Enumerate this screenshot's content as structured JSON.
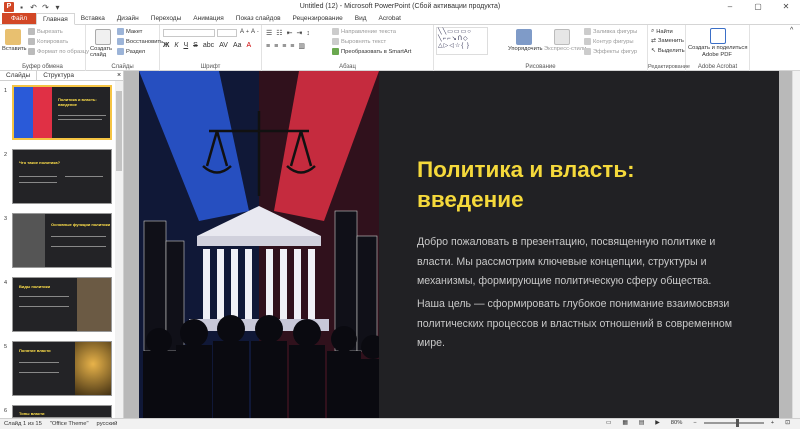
{
  "window": {
    "title": "Untitled (12) - Microsoft PowerPoint (Сбой активации продукта)",
    "logo": "P"
  },
  "tabs": [
    {
      "label": "Файл"
    },
    {
      "label": "Главная"
    },
    {
      "label": "Вставка"
    },
    {
      "label": "Дизайн"
    },
    {
      "label": "Переходы"
    },
    {
      "label": "Анимация"
    },
    {
      "label": "Показ слайдов"
    },
    {
      "label": "Рецензирование"
    },
    {
      "label": "Вид"
    },
    {
      "label": "Acrobat"
    }
  ],
  "ribbon": {
    "clipboard": {
      "paste": "Вставить",
      "cut": "Вырезать",
      "copy": "Копировать",
      "format": "Формат по образцу",
      "label": "Буфер обмена"
    },
    "slides": {
      "new": "Создать слайд",
      "layout": "Макет",
      "reset": "Восстановить",
      "section": "Раздел",
      "label": "Слайды"
    },
    "font": {
      "label": "Шрифт"
    },
    "paragraph": {
      "direction": "Направление текста",
      "align": "Выровнять текст",
      "smartart": "Преобразовать в SmartArt",
      "label": "Абзац"
    },
    "drawing": {
      "arrange": "Упорядочить",
      "styles": "Экспресс-стили",
      "fill": "Заливка фигуры",
      "outline": "Контур фигуры",
      "effects": "Эффекты фигур",
      "label": "Рисование"
    },
    "editing": {
      "find": "Найти",
      "replace": "Заменить",
      "select": "Выделить",
      "label": "Редактирование"
    },
    "acrobat": {
      "create": "Создать и поделиться",
      "create2": "Adobe PDF",
      "label": "Adobe Acrobat"
    }
  },
  "panel": {
    "tab_slides": "Слайды",
    "tab_outline": "Структура",
    "close": "×"
  },
  "thumbnails": [
    {
      "num": "1",
      "title": "Политика и власть: введение"
    },
    {
      "num": "2",
      "title": "Что такое политика?"
    },
    {
      "num": "3",
      "title": "Основные функции политики"
    },
    {
      "num": "4",
      "title": "Виды политики"
    },
    {
      "num": "5",
      "title": "Понятие власти"
    },
    {
      "num": "6",
      "title": "Типы власти"
    }
  ],
  "slide": {
    "title_line1": "Политика и власть:",
    "title_line2": "введение",
    "para1": "Добро пожаловать в презентацию, посвященную политике и власти. Мы рассмотрим ключевые концепции, структуры и механизмы, формирующие политическую сферу общества.",
    "para2": "Наша цель — сформировать глубокое понимание взаимосвязи политических процессов и властных отношений в современном мире."
  },
  "status": {
    "slide": "Слайд 1 из 15",
    "theme": "\"Office Theme\"",
    "lang": "русский",
    "zoom": "80%"
  },
  "colors": {
    "accent": "#d24726",
    "title_yellow": "#f5d93b",
    "red": "#e03045",
    "blue": "#2a5ad8"
  }
}
